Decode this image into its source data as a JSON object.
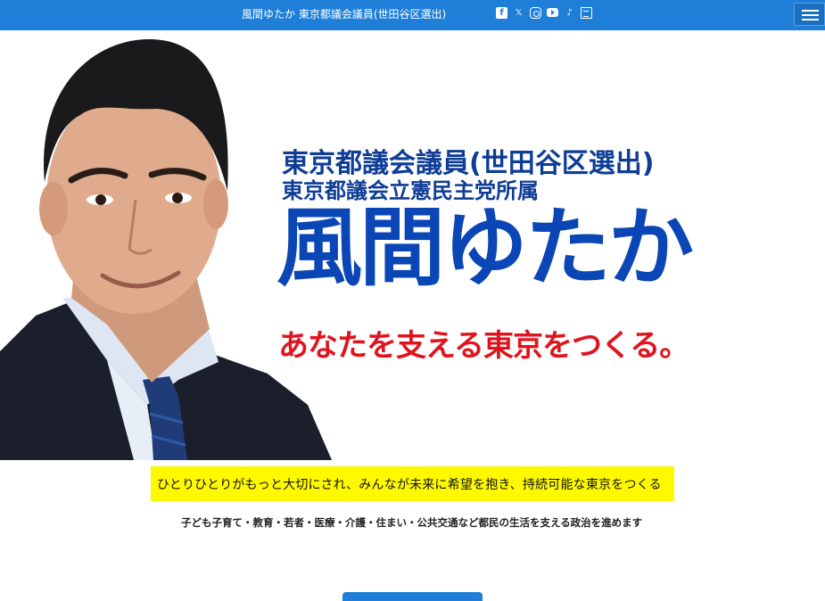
{
  "header": {
    "site_title": "風間ゆたか 東京都議会議員(世田谷区選出)",
    "social_icons": [
      "facebook-icon",
      "x-icon",
      "instagram-icon",
      "youtube-icon",
      "tiktok-icon",
      "note-icon"
    ],
    "menu_icon": "hamburger-menu-icon"
  },
  "hero": {
    "title_line1": "東京都議会議員(世田谷区選出)",
    "title_line2": "東京都議会立憲民主党所属",
    "name": "風間ゆたか",
    "slogan": "あなたを支える東京をつくる。"
  },
  "banner": {
    "text": "ひとりひとりがもっと大切にされ、みんなが未来に希望を抱き、持続可能な東京をつくる"
  },
  "subtext": "子ども子育て・教育・若者・医療・介護・住まい・公共交通など都民の生活を支える政治を進めます",
  "colors": {
    "header_bg": "#1f7fd8",
    "name_blue": "#0a46b5",
    "title_blue": "#0f3d96",
    "slogan_red": "#e0141e",
    "banner_yellow": "#fff900"
  }
}
